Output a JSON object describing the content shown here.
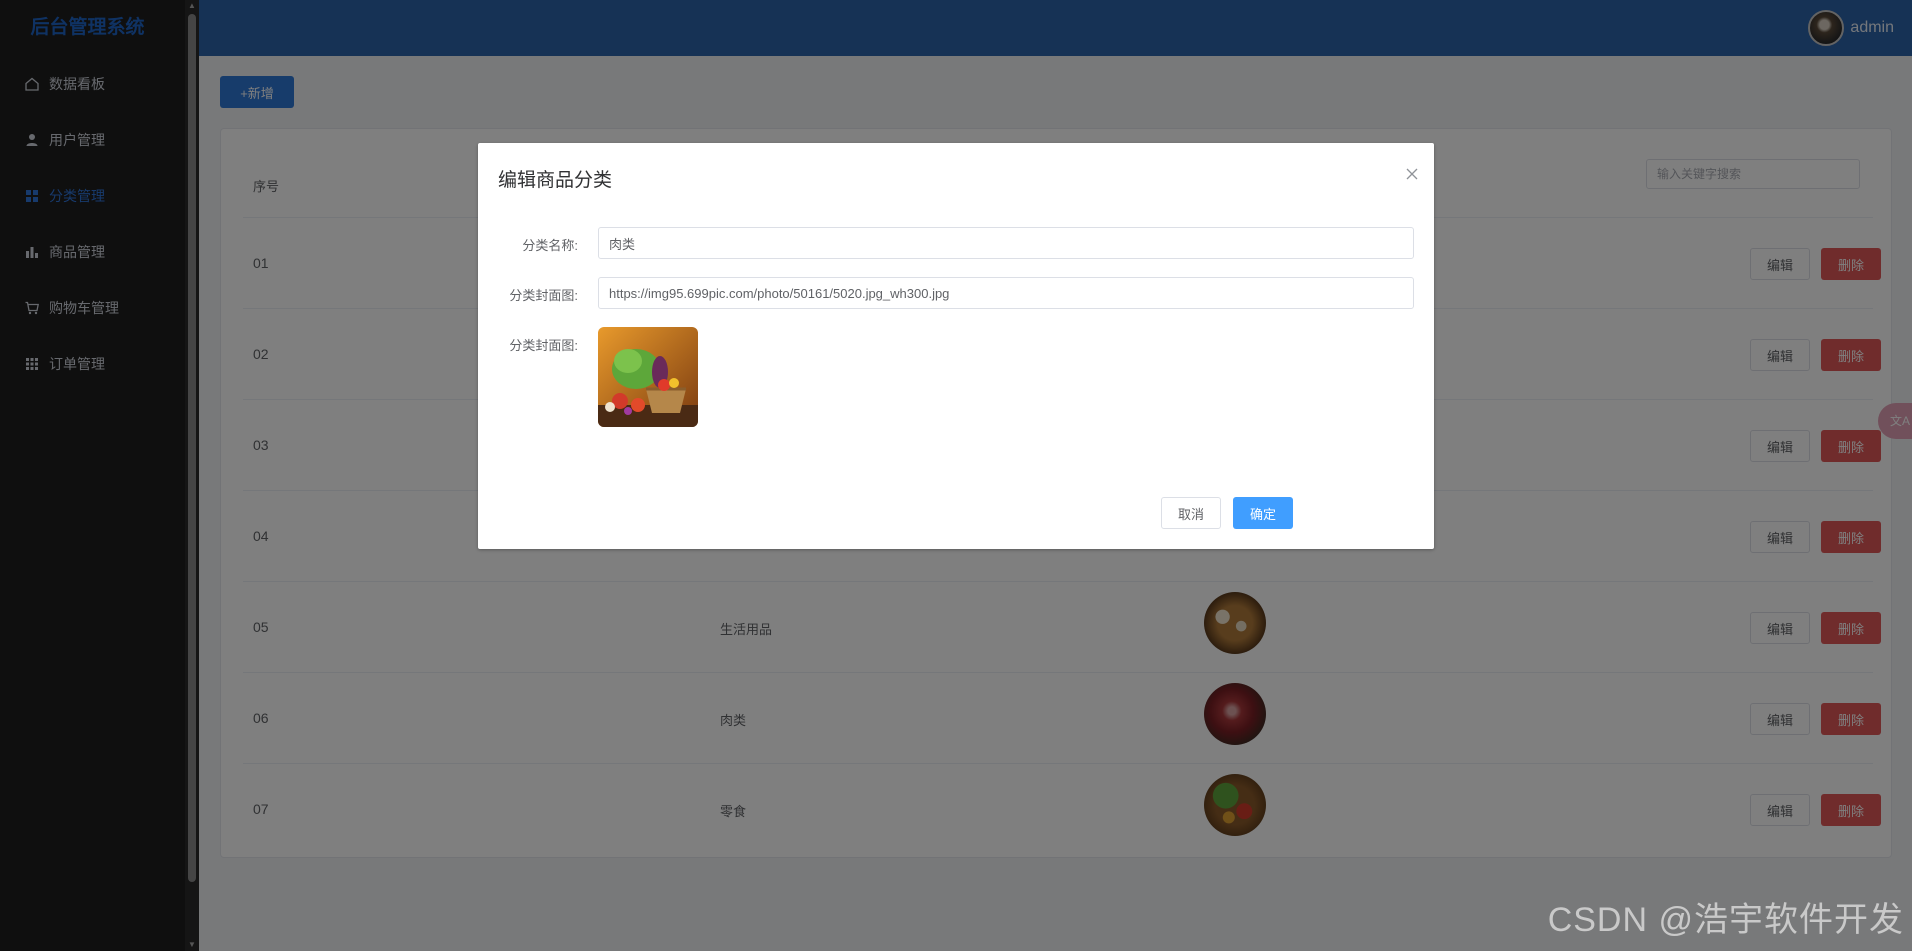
{
  "app": {
    "title": "后台管理系统"
  },
  "sidebar": {
    "items": [
      {
        "label": "数据看板",
        "icon": "home-icon",
        "active": false
      },
      {
        "label": "用户管理",
        "icon": "user-icon",
        "active": false
      },
      {
        "label": "分类管理",
        "icon": "grid-icon",
        "active": true
      },
      {
        "label": "商品管理",
        "icon": "bar-chart-icon",
        "active": false
      },
      {
        "label": "购物车管理",
        "icon": "cart-icon",
        "active": false
      },
      {
        "label": "订单管理",
        "icon": "apps-icon",
        "active": false
      }
    ]
  },
  "header": {
    "username": "admin"
  },
  "toolbar": {
    "add_label": "+新增"
  },
  "table": {
    "headers": {
      "index": "序号"
    },
    "search_placeholder": "输入关键字搜索",
    "rows": [
      {
        "index": "01",
        "name": "",
        "has_image": false
      },
      {
        "index": "02",
        "name": "",
        "has_image": false
      },
      {
        "index": "03",
        "name": "",
        "has_image": false
      },
      {
        "index": "04",
        "name": "",
        "has_image": false
      },
      {
        "index": "05",
        "name": "生活用品",
        "has_image": true,
        "image": "eggs-bread"
      },
      {
        "index": "06",
        "name": "肉类",
        "has_image": true,
        "image": "steak"
      },
      {
        "index": "07",
        "name": "零食",
        "has_image": true,
        "image": "vegetables"
      }
    ],
    "edit_label": "编辑",
    "delete_label": "删除"
  },
  "dialog": {
    "title": "编辑商品分类",
    "fields": {
      "name_label": "分类名称:",
      "name_value": "肉类",
      "cover_url_label": "分类封面图:",
      "cover_url_value": "https://img95.699pic.com/photo/50161/5020.jpg_wh300.jpg",
      "cover_preview_label": "分类封面图:"
    },
    "cancel_label": "取消",
    "confirm_label": "确定"
  },
  "watermark": "CSDN @浩宇软件开发",
  "colors": {
    "header": "#2d64aa",
    "sidebar": "#1f1f1f",
    "primary": "#409eff",
    "danger": "#e15959",
    "active_menu": "#2f74d8"
  }
}
